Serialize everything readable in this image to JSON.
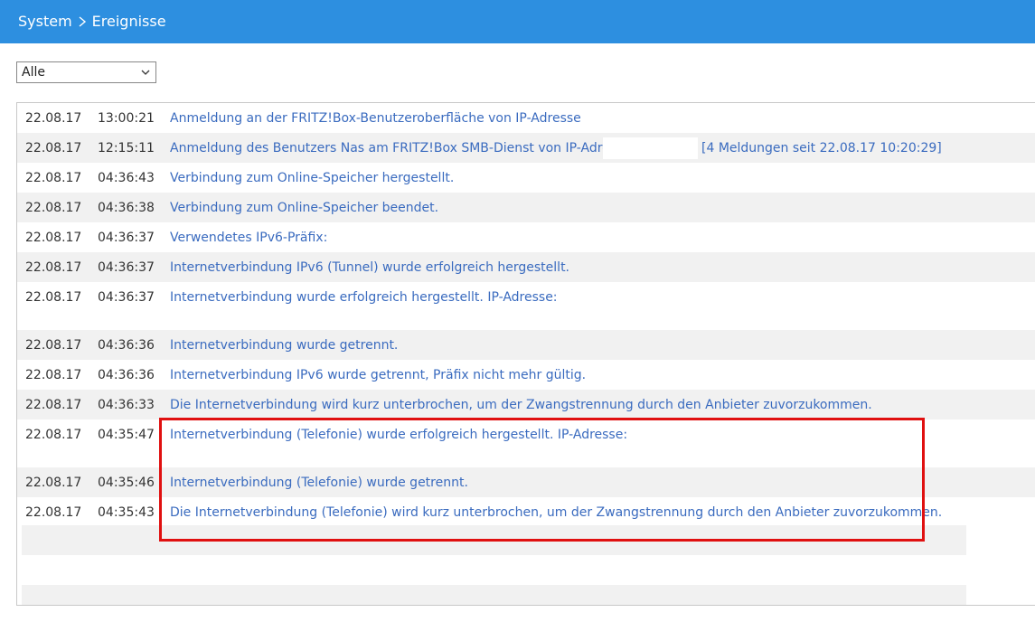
{
  "header": {
    "breadcrumb": [
      "System",
      "Ereignisse"
    ]
  },
  "filter": {
    "selected": "Alle"
  },
  "events": [
    {
      "date": "22.08.17",
      "time": "13:00:21",
      "message": "Anmeldung an der FRITZ!Box-Benutzeroberfläche von IP-Adresse"
    },
    {
      "date": "22.08.17",
      "time": "12:15:11",
      "message": "Anmeldung des Benutzers Nas am FRITZ!Box SMB-Dienst von IP-Adresse",
      "extra": "[4 Meldungen seit 22.08.17 10:20:29]"
    },
    {
      "date": "22.08.17",
      "time": "04:36:43",
      "message": "Verbindung zum Online-Speicher hergestellt."
    },
    {
      "date": "22.08.17",
      "time": "04:36:38",
      "message": "Verbindung zum Online-Speicher beendet."
    },
    {
      "date": "22.08.17",
      "time": "04:36:37",
      "message": "Verwendetes IPv6-Präfix:"
    },
    {
      "date": "22.08.17",
      "time": "04:36:37",
      "message": "Internetverbindung IPv6 (Tunnel) wurde erfolgreich hergestellt."
    },
    {
      "date": "22.08.17",
      "time": "04:36:37",
      "message": "Internetverbindung wurde erfolgreich hergestellt. IP-Adresse:"
    },
    {
      "date": "22.08.17",
      "time": "04:36:36",
      "message": "Internetverbindung wurde getrennt."
    },
    {
      "date": "22.08.17",
      "time": "04:36:36",
      "message": "Internetverbindung IPv6 wurde getrennt, Präfix nicht mehr gültig."
    },
    {
      "date": "22.08.17",
      "time": "04:36:33",
      "message": "Die Internetverbindung wird kurz unterbrochen, um der Zwangstrennung durch den Anbieter zuvorzukommen."
    },
    {
      "date": "22.08.17",
      "time": "04:35:47",
      "message": "Internetverbindung (Telefonie) wurde erfolgreich hergestellt. IP-Adresse:"
    },
    {
      "date": "22.08.17",
      "time": "04:35:46",
      "message": "Internetverbindung (Telefonie) wurde getrennt."
    },
    {
      "date": "22.08.17",
      "time": "04:35:43",
      "message": "Die Internetverbindung (Telefonie) wird kurz unterbrochen, um der Zwangstrennung durch den Anbieter zuvorzukommen."
    }
  ],
  "colors": {
    "header_bg": "#2d8fe0",
    "link_text": "#3a6bbf",
    "row_alt": "#f1f1f1",
    "highlight_border": "#e01010"
  }
}
